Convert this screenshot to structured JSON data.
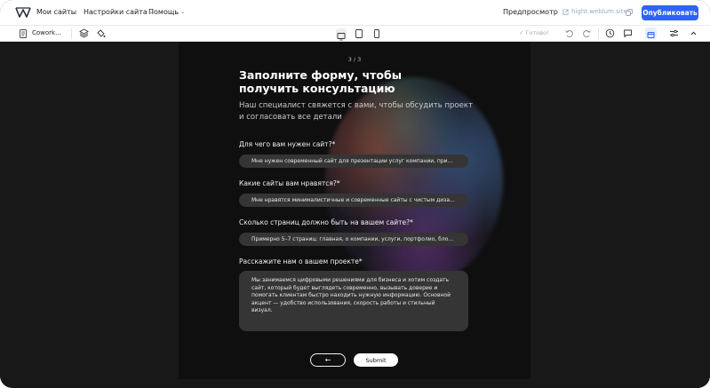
{
  "header": {
    "brand": "Мои сайты",
    "menu": [
      {
        "label": "Настройки сайта"
      },
      {
        "label": "Помощь"
      }
    ],
    "preview_label": "Предпросмотр",
    "site_link": "hight.weblum.site",
    "publish_label": "Опубликовать"
  },
  "toolbar": {
    "page_name": "Cowork...",
    "saved_label": "✓ Готово!"
  },
  "form": {
    "step": "3 / 3",
    "title": "Заполните форму, чтобы получить консультацию",
    "subtitle": "Наш специалист свяжется с вами, чтобы обсудить проект и согласовать все детали",
    "questions": [
      {
        "label": "Для чего вам нужен сайт?*",
        "value": "Мне нужен современный сайт для презентации услуг компании, привл..."
      },
      {
        "label": "Какие сайты вам нравятся?*",
        "value": "Мне нравятся минималистичные и современные сайты с чистым диза..."
      },
      {
        "label": "Сколько страниц должно быть на вашем сайте?*",
        "value": "Примерно 5–7 страниц: главная, о компании, услуги, портфолио, блог, ..."
      }
    ],
    "project_label": "Расскажите нам о вашем проекте*",
    "project_text": "Мы занимаемся цифровыми решениями для бизнеса и хотим создать сайт, который будет выглядеть современно, вызывать доверие и помогать клиентам быстро находить нужную информацию. Основной акцент — удобство использования, скорость работы и стильный визуал.",
    "back_icon": "←",
    "submit_label": "Submit"
  }
}
